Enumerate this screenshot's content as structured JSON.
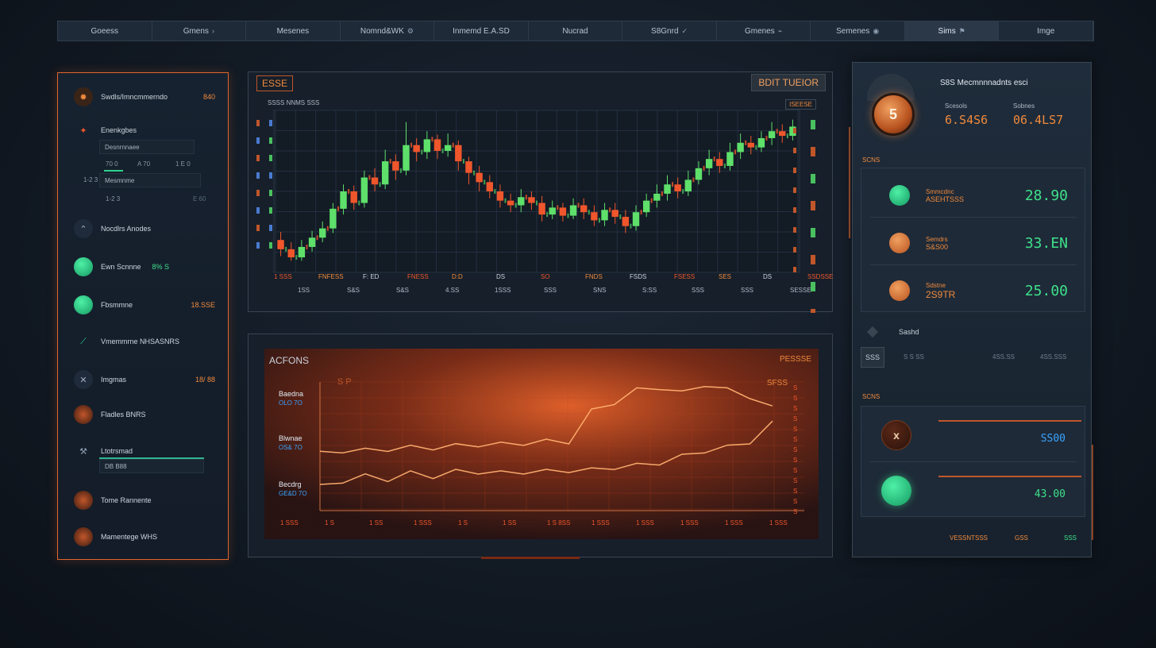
{
  "nav": {
    "tabs": [
      {
        "label": "Goeess",
        "icon": ""
      },
      {
        "label": "Gmens",
        "icon": "›"
      },
      {
        "label": "Mesenes",
        "icon": ""
      },
      {
        "label": "Nomnd&WK",
        "icon": "⚙"
      },
      {
        "label": "Inmemd E.A.SD",
        "icon": ""
      },
      {
        "label": "Nucrad",
        "icon": ""
      },
      {
        "label": "S8Gnrd",
        "icon": "✓"
      },
      {
        "label": "Gmenes",
        "icon": "⌁"
      },
      {
        "label": "Semenes",
        "icon": "◉"
      },
      {
        "label": "Sims",
        "icon": "⚑"
      },
      {
        "label": "Imge",
        "icon": ""
      }
    ],
    "active_index": 9
  },
  "sidebar": {
    "items": [
      {
        "icon": "gear-icon",
        "label": "Swdls/Imncmmerndo",
        "value": "840"
      },
      {
        "icon": "flame-icon",
        "label": "Enenkgbes"
      },
      {
        "icon": "x-icon",
        "label": "Mesmnme",
        "sub": "Desnrnnaee"
      },
      {
        "icon": "chevron-icon",
        "label": "Nocdlrs Anodes"
      },
      {
        "icon": "circle-icon",
        "label": "Ewn Scnnne",
        "value": "8% S"
      },
      {
        "icon": "circle-icon",
        "label": "Fbsmmne",
        "value": "18.SSE"
      },
      {
        "icon": "chart-icon",
        "label": "Vmemmrne NHSASNRS"
      },
      {
        "icon": "x-icon",
        "label": "Imgmas",
        "value": "18/ 88"
      },
      {
        "icon": "circle-icon",
        "label": "Fladles BNRS"
      },
      {
        "icon": "tools-icon",
        "label": "Ltotrsmad",
        "sub": "DB B88"
      },
      {
        "icon": "circle-icon",
        "label": "Tome Rannente"
      },
      {
        "icon": "circle-icon",
        "label": "Mamentege WHS"
      }
    ],
    "mini_labels": [
      "70 0",
      "A 70",
      "1 E 0",
      "1-2 3",
      "E 60"
    ]
  },
  "candle": {
    "title": "ESSE",
    "button": "BDIT TUEIOR",
    "subtitle": "SSSS NNMS SSS",
    "badge": "ISEESE",
    "x_labels_top": [
      "1 SSS",
      "FNFESS",
      "F: ED",
      "FNESS",
      "D:D",
      "DS",
      "SO",
      "FNDS",
      "FSDS",
      "FSESS",
      "SES",
      "DS",
      "SSDSSE"
    ],
    "x_labels_bottom": [
      "1SS",
      "S&S",
      "S&S",
      "4.SS",
      "1SSS",
      "SSS",
      "SNS",
      "S:SS",
      "SSS",
      "SSS",
      "SESSE"
    ]
  },
  "area": {
    "title": "ACFONS",
    "badge": "PESSSE",
    "legend": [
      {
        "label": "Baedna",
        "sub": "OLO 7O"
      },
      {
        "label": "Blwnae",
        "sub": "OS& 7O"
      },
      {
        "label": "Becdrg",
        "sub": "GE&D 7O"
      }
    ],
    "top_label": "S P",
    "right_label": "SFSS",
    "x_labels": [
      "1 SSS",
      "1 S",
      "1 SS",
      "1 SSS",
      "1 S",
      "1 SS",
      "1 S 8SS",
      "1 SSS",
      "1 SSS",
      "1 SSS",
      "1 SSS",
      "1 SSS"
    ],
    "y_labels": [
      "S",
      "S",
      "S",
      "S",
      "S",
      "S",
      "S",
      "S",
      "S",
      "S",
      "S",
      "S",
      "S"
    ]
  },
  "right": {
    "coin_label": "5",
    "header": "S8S Mecmnnnadnts esci",
    "stat1": {
      "label": "Scesols",
      "value": "6.S4S6"
    },
    "stat2": {
      "label": "Sobnes",
      "value": "06.4LS7"
    },
    "section1": "SCNS",
    "rows": [
      {
        "name": "Smmcdnc",
        "sub": "ASEHTSSS",
        "value": "28.90",
        "coin": "green"
      },
      {
        "name": "Semdrs",
        "sub": "S&S00",
        "value": "33.EN",
        "coin": "orange"
      },
      {
        "name": "Sdstne",
        "sub": "2S9TR",
        "value": "25.00",
        "coin": "orange"
      }
    ],
    "badge_row": {
      "label": "Sashd",
      "box": "SSS",
      "values": [
        "S S SS",
        "4SS.SS",
        "4SS.SSS"
      ]
    },
    "section2": "SCNS",
    "cards": [
      {
        "icon": "x",
        "value": "SS00",
        "color": "blue"
      },
      {
        "icon": "",
        "value": "43.00",
        "color": "green"
      }
    ],
    "footer": [
      "VESSNTSSS",
      "GSS",
      "SSS"
    ]
  },
  "chart_data": [
    {
      "type": "bar",
      "candles": [
        {
          "o": 128,
          "c": 120,
          "h": 135,
          "l": 114
        },
        {
          "o": 120,
          "c": 113,
          "h": 126,
          "l": 110
        },
        {
          "o": 113,
          "c": 122,
          "h": 128,
          "l": 110
        },
        {
          "o": 122,
          "c": 130,
          "h": 136,
          "l": 118
        },
        {
          "o": 130,
          "c": 138,
          "h": 144,
          "l": 126
        },
        {
          "o": 138,
          "c": 155,
          "h": 160,
          "l": 134
        },
        {
          "o": 155,
          "c": 170,
          "h": 176,
          "l": 150
        },
        {
          "o": 170,
          "c": 160,
          "h": 175,
          "l": 154
        },
        {
          "o": 160,
          "c": 182,
          "h": 188,
          "l": 156
        },
        {
          "o": 182,
          "c": 176,
          "h": 190,
          "l": 170
        },
        {
          "o": 176,
          "c": 196,
          "h": 206,
          "l": 172
        },
        {
          "o": 196,
          "c": 188,
          "h": 202,
          "l": 180
        },
        {
          "o": 188,
          "c": 210,
          "h": 230,
          "l": 184
        },
        {
          "o": 210,
          "c": 204,
          "h": 216,
          "l": 196
        },
        {
          "o": 204,
          "c": 215,
          "h": 222,
          "l": 198
        },
        {
          "o": 215,
          "c": 205,
          "h": 219,
          "l": 198
        },
        {
          "o": 205,
          "c": 210,
          "h": 220,
          "l": 200
        },
        {
          "o": 210,
          "c": 196,
          "h": 214,
          "l": 188
        },
        {
          "o": 196,
          "c": 186,
          "h": 200,
          "l": 176
        },
        {
          "o": 186,
          "c": 178,
          "h": 192,
          "l": 170
        },
        {
          "o": 178,
          "c": 170,
          "h": 184,
          "l": 164
        },
        {
          "o": 170,
          "c": 162,
          "h": 176,
          "l": 156
        },
        {
          "o": 162,
          "c": 158,
          "h": 168,
          "l": 152
        },
        {
          "o": 158,
          "c": 165,
          "h": 172,
          "l": 152
        },
        {
          "o": 165,
          "c": 160,
          "h": 170,
          "l": 154
        },
        {
          "o": 160,
          "c": 150,
          "h": 166,
          "l": 144
        },
        {
          "o": 150,
          "c": 156,
          "h": 162,
          "l": 146
        },
        {
          "o": 156,
          "c": 149,
          "h": 160,
          "l": 144
        },
        {
          "o": 149,
          "c": 158,
          "h": 164,
          "l": 146
        },
        {
          "o": 158,
          "c": 152,
          "h": 164,
          "l": 146
        },
        {
          "o": 152,
          "c": 145,
          "h": 158,
          "l": 140
        },
        {
          "o": 145,
          "c": 154,
          "h": 160,
          "l": 140
        },
        {
          "o": 154,
          "c": 148,
          "h": 160,
          "l": 142
        },
        {
          "o": 148,
          "c": 140,
          "h": 154,
          "l": 134
        },
        {
          "o": 140,
          "c": 152,
          "h": 158,
          "l": 136
        },
        {
          "o": 152,
          "c": 162,
          "h": 168,
          "l": 148
        },
        {
          "o": 162,
          "c": 168,
          "h": 176,
          "l": 156
        },
        {
          "o": 168,
          "c": 176,
          "h": 184,
          "l": 162
        },
        {
          "o": 176,
          "c": 170,
          "h": 182,
          "l": 164
        },
        {
          "o": 170,
          "c": 180,
          "h": 188,
          "l": 166
        },
        {
          "o": 180,
          "c": 190,
          "h": 196,
          "l": 176
        },
        {
          "o": 190,
          "c": 198,
          "h": 206,
          "l": 184
        },
        {
          "o": 198,
          "c": 192,
          "h": 204,
          "l": 186
        },
        {
          "o": 192,
          "c": 204,
          "h": 212,
          "l": 188
        },
        {
          "o": 204,
          "c": 212,
          "h": 220,
          "l": 198
        },
        {
          "o": 212,
          "c": 208,
          "h": 218,
          "l": 202
        },
        {
          "o": 208,
          "c": 216,
          "h": 222,
          "l": 204
        },
        {
          "o": 216,
          "c": 222,
          "h": 230,
          "l": 210
        },
        {
          "o": 222,
          "c": 218,
          "h": 228,
          "l": 212
        },
        {
          "o": 218,
          "c": 226,
          "h": 232,
          "l": 214
        }
      ],
      "ylim": [
        100,
        240
      ]
    },
    {
      "type": "line",
      "series": [
        {
          "values": [
            42,
            44,
            44,
            45,
            46,
            46,
            47,
            48,
            48,
            49,
            50,
            50,
            70,
            76,
            84,
            86,
            82,
            88,
            84,
            80,
            72
          ]
        },
        {
          "values": [
            20,
            24,
            27,
            25,
            29,
            27,
            30,
            30,
            29,
            30,
            30,
            31,
            31,
            33,
            34,
            36,
            40,
            44,
            46,
            50,
            62
          ]
        }
      ],
      "ylim": [
        0,
        100
      ]
    }
  ]
}
